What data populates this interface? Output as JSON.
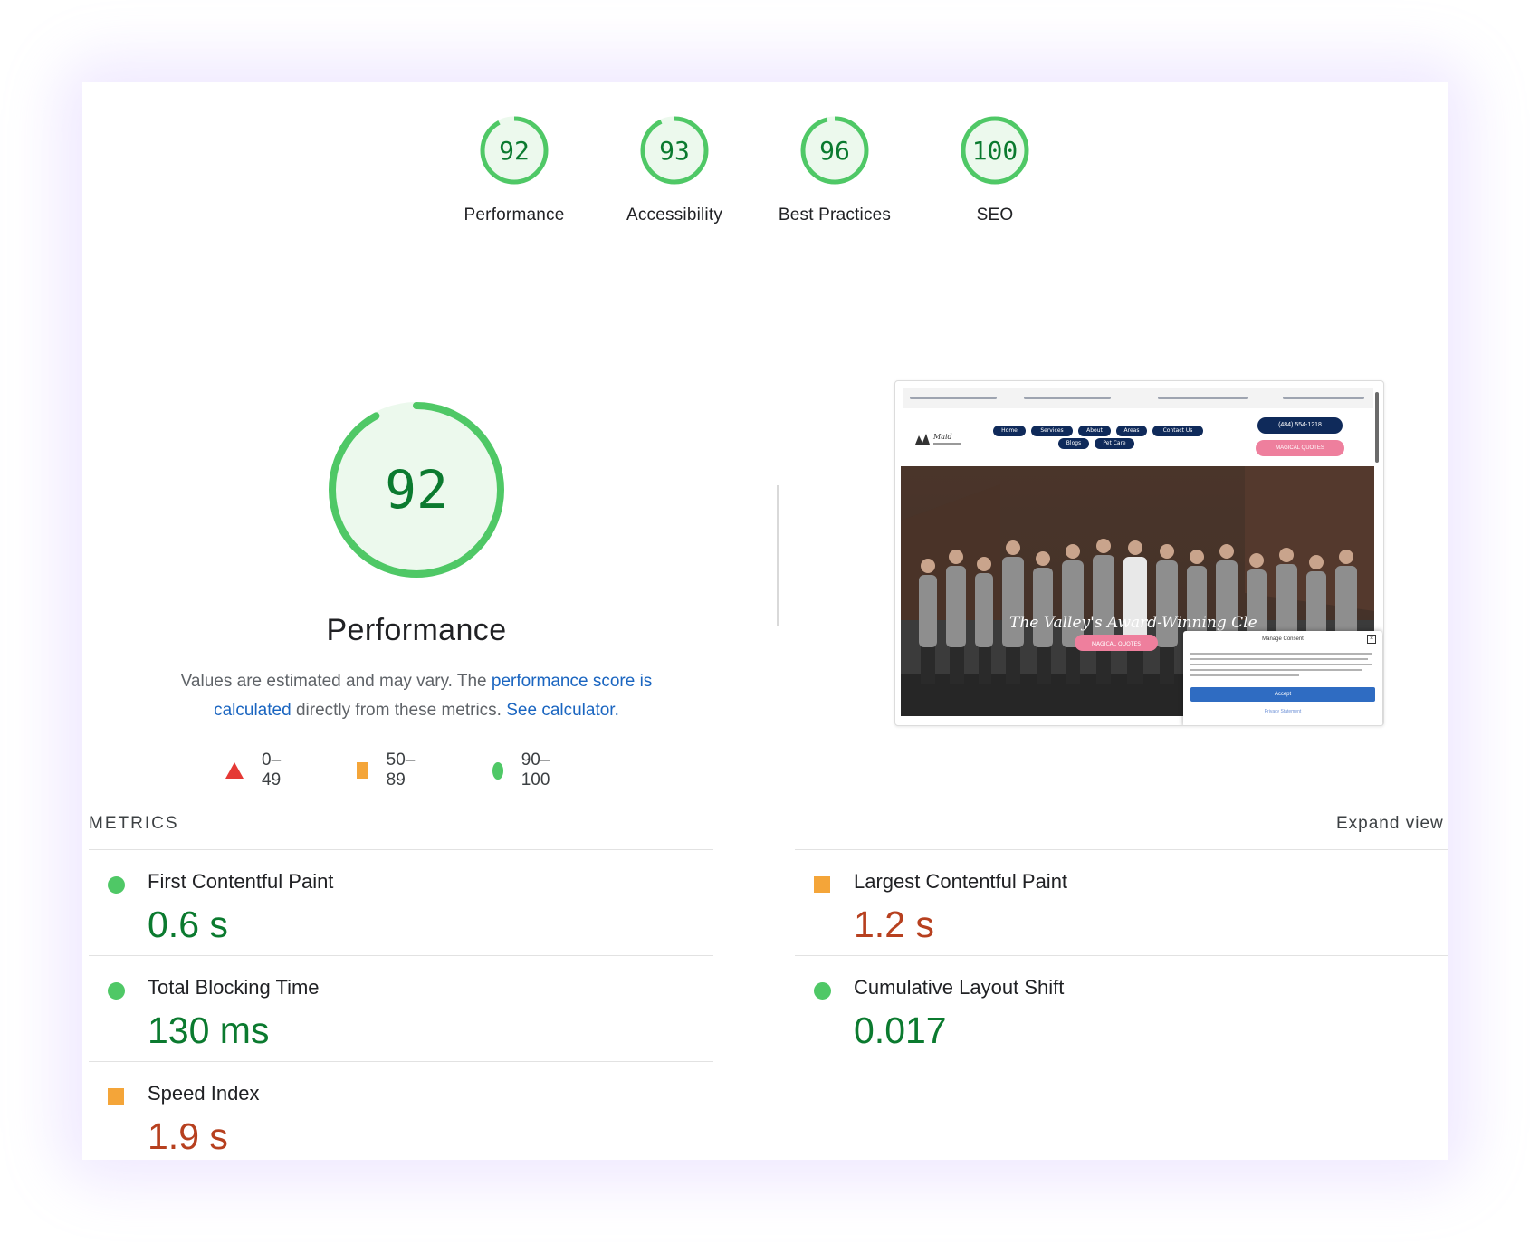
{
  "summary": {
    "gauges": [
      {
        "label": "Performance",
        "score": "92",
        "value": 92
      },
      {
        "label": "Accessibility",
        "score": "93",
        "value": 93
      },
      {
        "label": "Best Practices",
        "score": "96",
        "value": 96
      },
      {
        "label": "SEO",
        "score": "100",
        "value": 100
      }
    ]
  },
  "performance": {
    "score": "92",
    "value": 92,
    "title": "Performance",
    "desc_prefix": "Values are estimated and may vary. The ",
    "desc_link1": "performance score is calculated",
    "desc_middle": " directly from these metrics. ",
    "desc_link2": "See calculator.",
    "legend": [
      {
        "shape": "triangle",
        "range": "0–49",
        "color": "#e53935"
      },
      {
        "shape": "square",
        "range": "50–89",
        "color": "#f4a539"
      },
      {
        "shape": "circle",
        "range": "90–100",
        "color": "#4fc866"
      }
    ]
  },
  "thumbnail": {
    "nav": [
      "Home",
      "Services",
      "About",
      "Areas",
      "Contact Us",
      "Blogs",
      "Pet Care"
    ],
    "phone": "(484) 554-1218",
    "quote": "MAGICAL QUOTES",
    "hero_quote": "MAGICAL QUOTES",
    "hero_text": "The Valley's Award-Winning Cle",
    "modal_title": "Manage Consent",
    "modal_accept": "Accept",
    "modal_privacy": "Privacy Statement"
  },
  "metrics": {
    "title": "METRICS",
    "expand_label": "Expand view",
    "items": [
      {
        "label": "First Contentful Paint",
        "value": "0.6 s",
        "status": "good"
      },
      {
        "label": "Largest Contentful Paint",
        "value": "1.2 s",
        "status": "average"
      },
      {
        "label": "Total Blocking Time",
        "value": "130 ms",
        "status": "good"
      },
      {
        "label": "Cumulative Layout Shift",
        "value": "0.017",
        "status": "good"
      },
      {
        "label": "Speed Index",
        "value": "1.9 s",
        "status": "average"
      }
    ]
  },
  "colors": {
    "pass": "#4fc866",
    "pass_text": "#0b7a2f",
    "average": "#f4a539",
    "average_text": "#b7401f",
    "fail": "#e53935",
    "link": "#1a65c0"
  }
}
